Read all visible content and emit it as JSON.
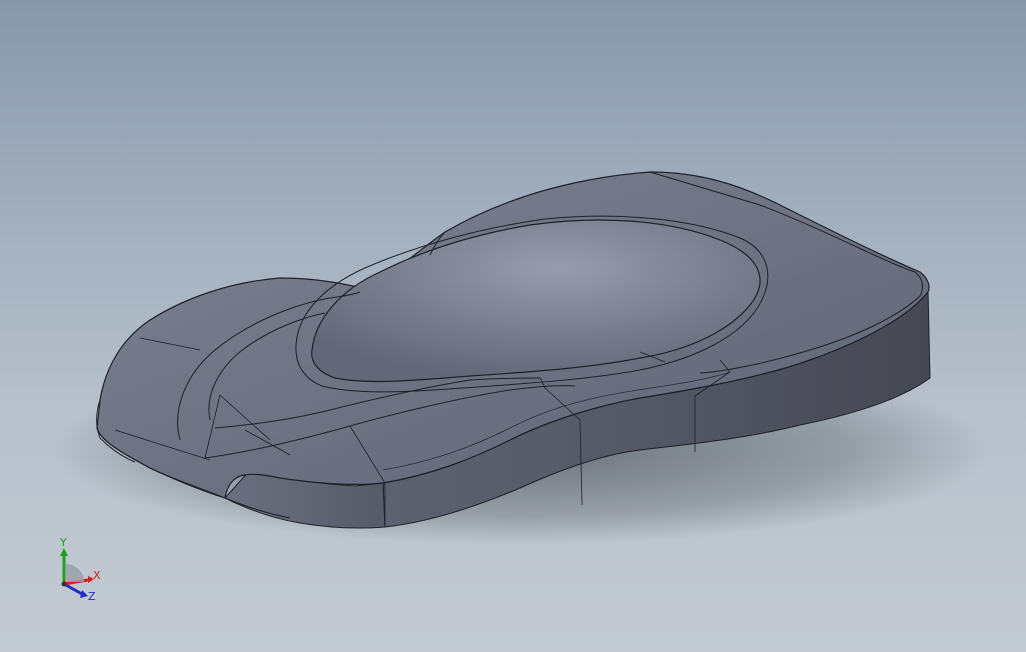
{
  "viewport": {
    "background_top": "#8898ab",
    "background_bottom": "#c3cad3",
    "model_face_color": "#6e7484",
    "model_dark_color": "#4c505b",
    "edge_color": "#1e2028"
  },
  "triad": {
    "y_label": "Y",
    "x_label": "X",
    "z_label": "Z",
    "y_color": "#1aa01a",
    "x_color": "#d02020",
    "z_color": "#2030c0"
  }
}
